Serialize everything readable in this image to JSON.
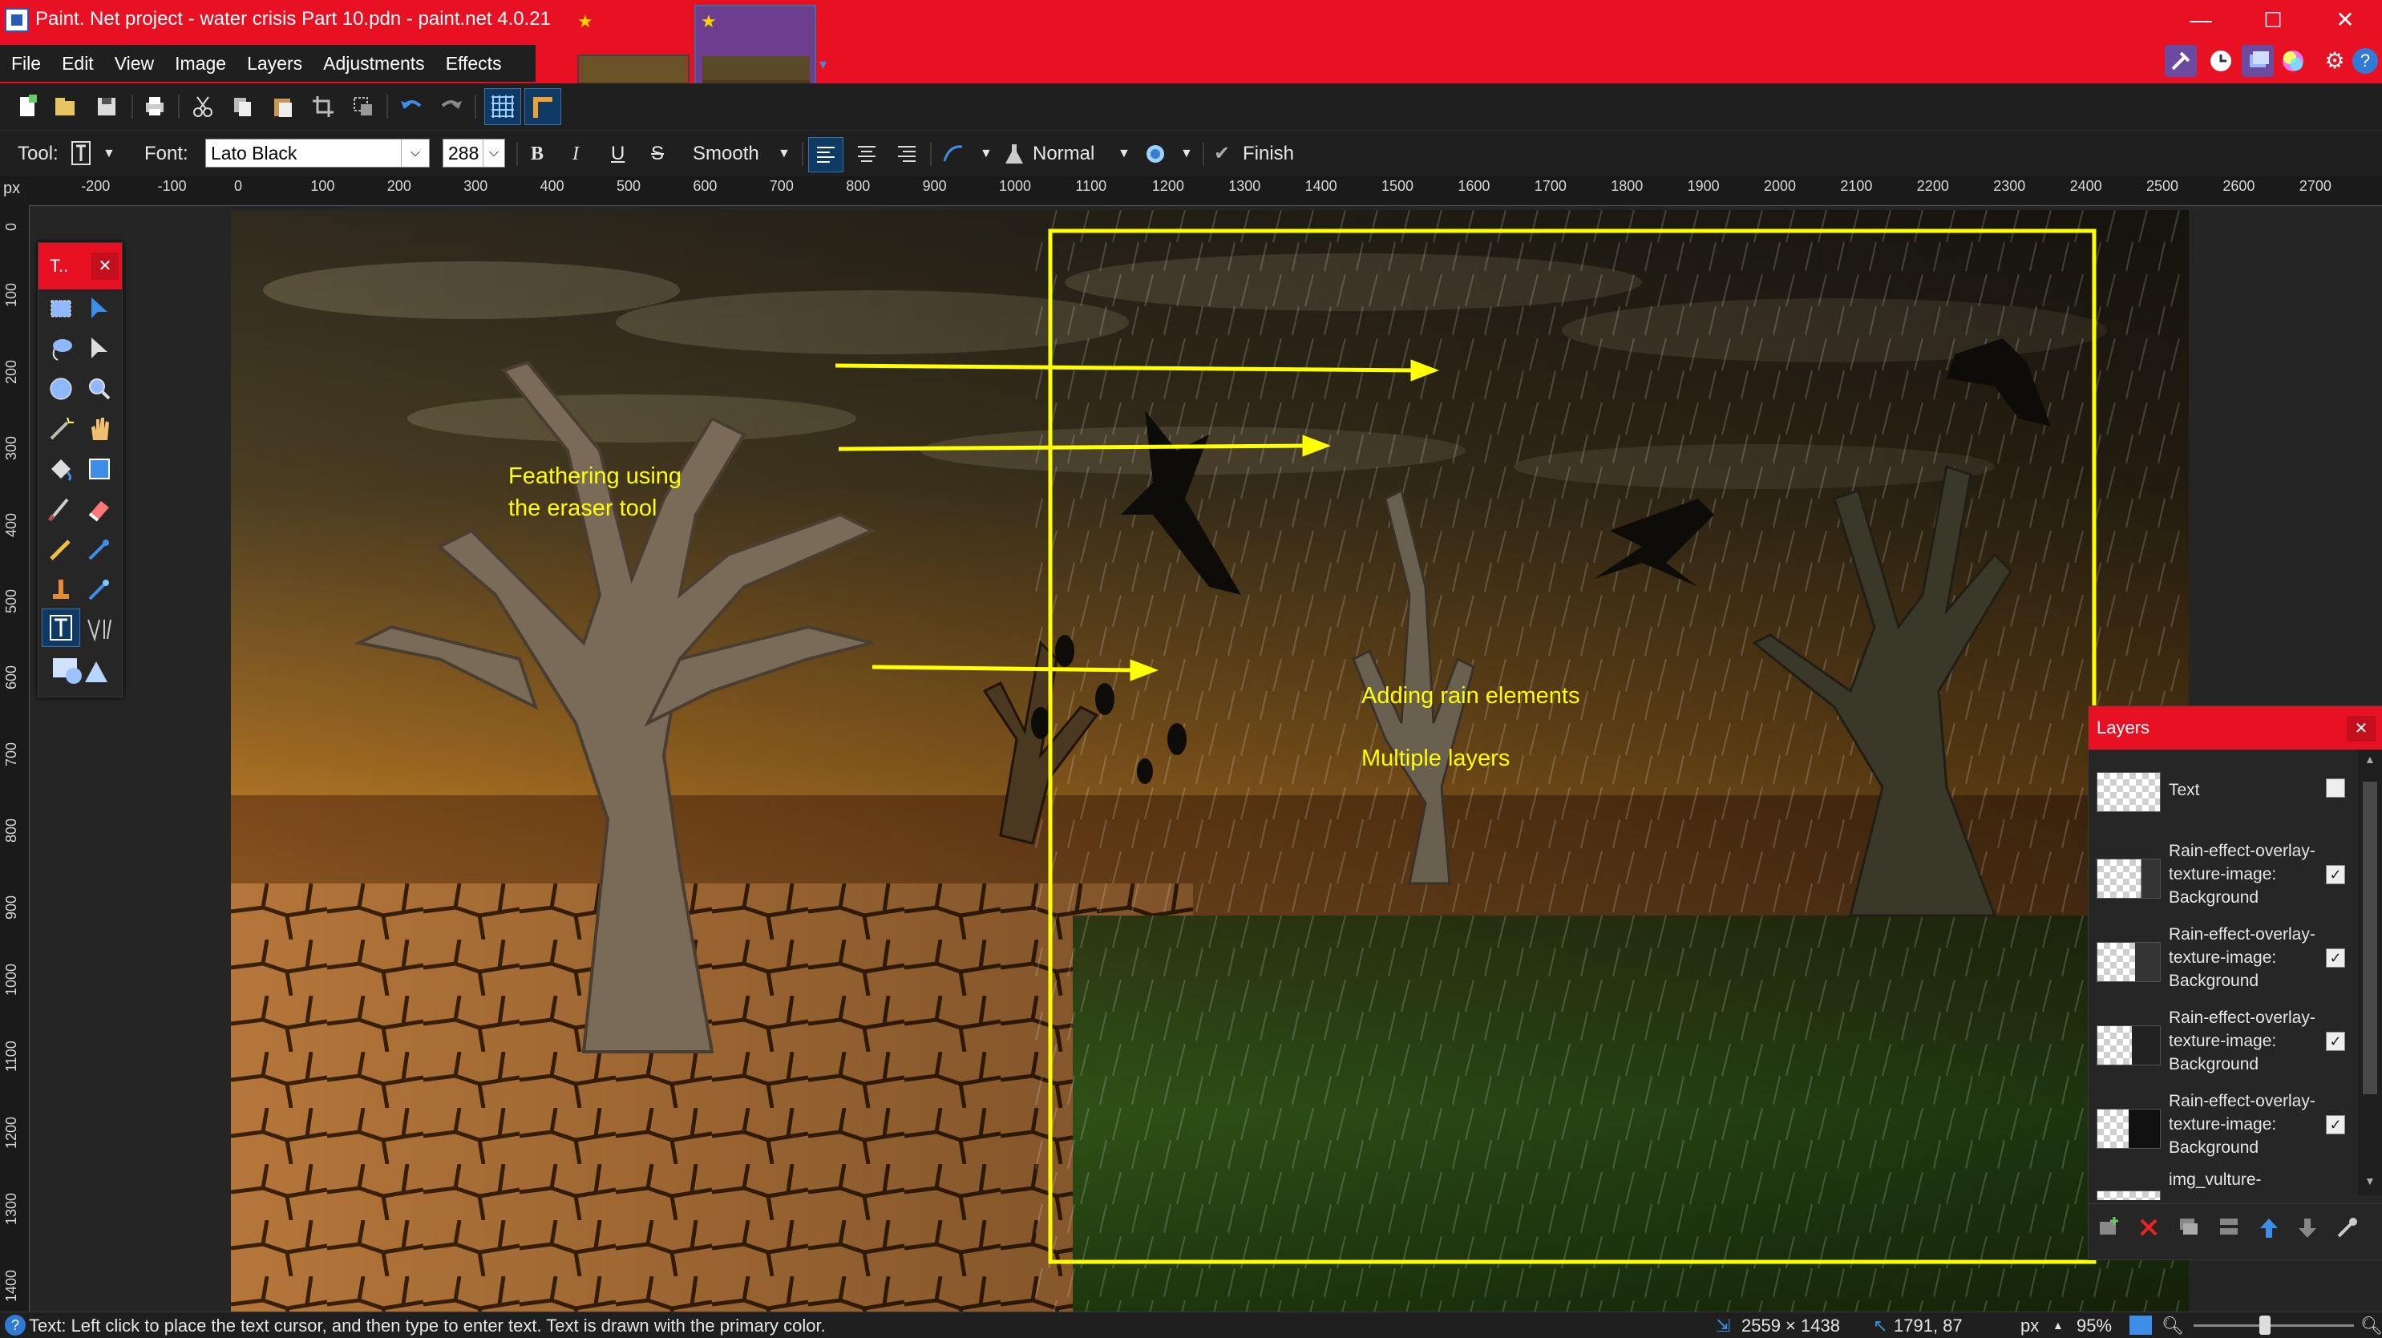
{
  "window": {
    "title": "Paint. Net project - water crisis Part 10.pdn - paint.net 4.0.21",
    "controls": {
      "minimize": "—",
      "maximize": "☐",
      "close": "✕"
    }
  },
  "menubar": {
    "items": [
      "File",
      "Edit",
      "View",
      "Image",
      "Layers",
      "Adjustments",
      "Effects"
    ]
  },
  "tabs": {
    "star": "★"
  },
  "toolbar2": {
    "tool_label": "Tool:",
    "font_label": "Font:",
    "font_value": "Lato Black",
    "size_value": "288",
    "bold": "B",
    "italic": "I",
    "underline": "U",
    "strike": "S",
    "antialias_value": "Smooth",
    "blend_value": "Normal",
    "finish_label": "Finish"
  },
  "ruler": {
    "unit": "px",
    "top_labels": [
      "-200",
      "-100",
      "0",
      "100",
      "200",
      "300",
      "400",
      "500",
      "600",
      "700",
      "800",
      "900",
      "1000",
      "1100",
      "1200",
      "1300",
      "1400",
      "1500",
      "1600",
      "1700",
      "1800",
      "1900",
      "2000",
      "2100",
      "2200",
      "2300",
      "2400",
      "2500",
      "2600",
      "2700"
    ],
    "left_labels": [
      "0",
      "100",
      "200",
      "300",
      "400",
      "500",
      "600",
      "700",
      "800",
      "900",
      "1000",
      "1100",
      "1200",
      "1300",
      "1400"
    ]
  },
  "annotations": {
    "feather_line1": "Feathering using",
    "feather_line2": "the eraser tool",
    "rain": "Adding rain elements",
    "layers": "Multiple layers",
    "color": "#ffff00"
  },
  "tools_panel": {
    "title": "T..",
    "close": "✕"
  },
  "layers_panel": {
    "title": "Layers",
    "close": "✕",
    "layers": [
      {
        "name": "Text",
        "checked": false
      },
      {
        "name": "Rain-effect-overlay-texture-image: Background",
        "checked": true
      },
      {
        "name": "Rain-effect-overlay-texture-image: Background",
        "checked": true
      },
      {
        "name": "Rain-effect-overlay-texture-image: Background",
        "checked": true
      },
      {
        "name": "Rain-effect-overlay-texture-image: Background",
        "checked": true
      },
      {
        "name": "img_vulture-",
        "checked": true
      }
    ]
  },
  "statusbar": {
    "hint": "Text: Left click to place the text cursor, and then type to enter text. Text is drawn with the primary color.",
    "image_size": "2559 × 1438",
    "cursor_pos": "1791, 87",
    "unit": "px",
    "zoom": "95%"
  },
  "colors": {
    "accent": "#e81123",
    "panel": "#262626",
    "annotation": "#ffff00"
  }
}
